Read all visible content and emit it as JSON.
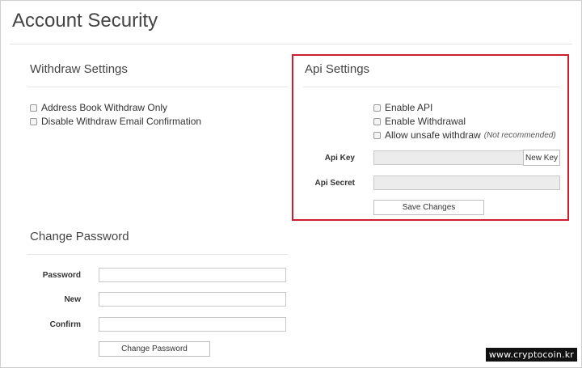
{
  "page": {
    "title": "Account Security"
  },
  "withdraw": {
    "title": "Withdraw Settings",
    "options": [
      {
        "label": "Address Book Withdraw Only",
        "checked": false
      },
      {
        "label": "Disable Withdraw Email Confirmation",
        "checked": false
      }
    ]
  },
  "api": {
    "title": "Api Settings",
    "options": [
      {
        "label": "Enable API",
        "checked": false
      },
      {
        "label": "Enable Withdrawal",
        "checked": false
      },
      {
        "label": "Allow unsafe withdraw",
        "note": "(Not recommended)",
        "checked": false
      }
    ],
    "key_label": "Api Key",
    "key_value": "",
    "new_key_button": "New Key",
    "secret_label": "Api Secret",
    "secret_value": "",
    "save_button": "Save Changes",
    "highlight_color": "#cc1f2e"
  },
  "password": {
    "title": "Change Password",
    "password_label": "Password",
    "new_label": "New",
    "confirm_label": "Confirm",
    "password_value": "",
    "new_value": "",
    "confirm_value": "",
    "change_button": "Change Password"
  },
  "watermark": "www.cryptocoin.kr"
}
